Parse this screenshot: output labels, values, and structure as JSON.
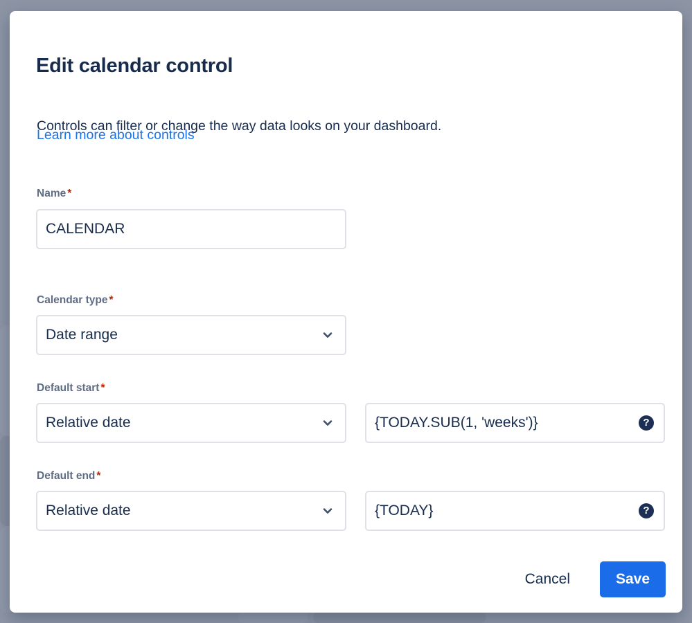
{
  "dialog": {
    "title": "Edit calendar control",
    "description": "Controls can filter or change the way data looks on your dashboard.",
    "link_label": "Learn more about controls",
    "required_marker": "*"
  },
  "fields": {
    "name": {
      "label": "Name",
      "required": true,
      "value": "CALENDAR"
    },
    "calendar_type": {
      "label": "Calendar type",
      "required": true,
      "value": "Date range",
      "chevron_icon": "chevron-down-icon"
    },
    "default_start": {
      "label": "Default start",
      "required": true,
      "mode_value": "Relative date",
      "expression_value": "{TODAY.SUB(1, 'weeks')}",
      "help_icon": "help-circle-icon",
      "help_glyph": "?"
    },
    "default_end": {
      "label": "Default end",
      "required": true,
      "mode_value": "Relative date",
      "expression_value": "{TODAY}",
      "help_icon": "help-circle-icon",
      "help_glyph": "?"
    }
  },
  "footer": {
    "cancel_label": "Cancel",
    "save_label": "Save"
  },
  "colors": {
    "accent_blue": "#1a6ce8",
    "link_blue": "#1a73e8",
    "required_red": "#bf2600",
    "text_dark": "#172b4d",
    "label_gray": "#5e6c84",
    "field_border": "#dfe1e6",
    "backdrop": "#8d95a5",
    "help_icon_bg": "#1d2f54"
  }
}
